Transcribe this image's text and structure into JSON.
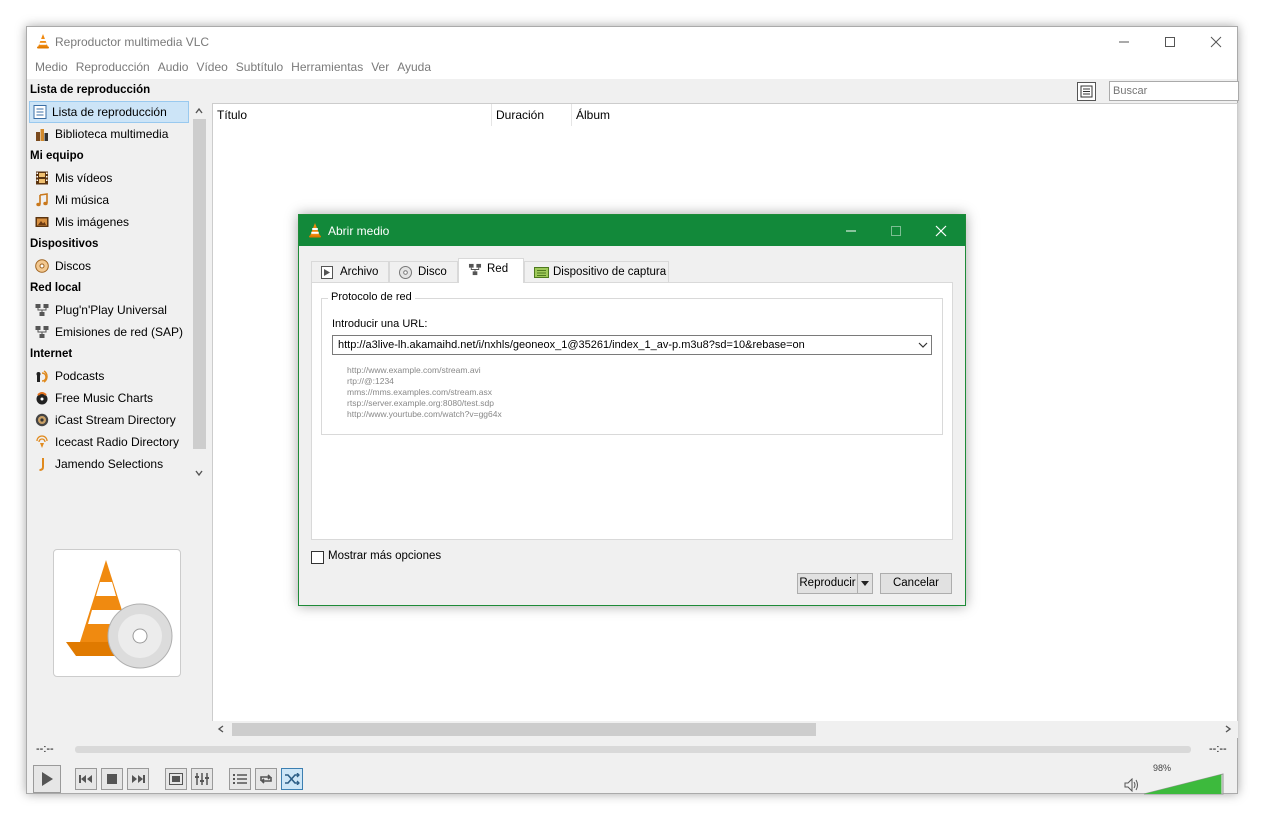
{
  "window": {
    "title": "Reproductor multimedia VLC"
  },
  "menu": [
    "Medio",
    "Reproducción",
    "Audio",
    "Vídeo",
    "Subtítulo",
    "Herramientas",
    "Ver",
    "Ayuda"
  ],
  "sidebar": {
    "header": "Lista de reproducción",
    "items": [
      {
        "type": "item",
        "label": "Lista de reproducción",
        "icon": "playlist-icon",
        "selected": true
      },
      {
        "type": "item",
        "label": "Biblioteca multimedia",
        "icon": "library-icon"
      },
      {
        "type": "section",
        "label": "Mi equipo"
      },
      {
        "type": "item",
        "label": "Mis vídeos",
        "icon": "film-icon"
      },
      {
        "type": "item",
        "label": "Mi música",
        "icon": "music-note-icon"
      },
      {
        "type": "item",
        "label": "Mis imágenes",
        "icon": "image-icon"
      },
      {
        "type": "section",
        "label": "Dispositivos"
      },
      {
        "type": "item",
        "label": "Discos",
        "icon": "disc-icon"
      },
      {
        "type": "section",
        "label": "Red local"
      },
      {
        "type": "item",
        "label": "Plug'n'Play Universal",
        "icon": "network-icon"
      },
      {
        "type": "item",
        "label": "Emisiones de red (SAP)",
        "icon": "network-icon"
      },
      {
        "type": "section",
        "label": "Internet"
      },
      {
        "type": "item",
        "label": "Podcasts",
        "icon": "podcast-icon"
      },
      {
        "type": "item",
        "label": "Free Music Charts",
        "icon": "charts-icon"
      },
      {
        "type": "item",
        "label": "iCast Stream Directory",
        "icon": "icast-icon"
      },
      {
        "type": "item",
        "label": "Icecast Radio Directory",
        "icon": "icecast-icon"
      },
      {
        "type": "item",
        "label": "Jamendo Selections",
        "icon": "jamendo-icon"
      }
    ]
  },
  "search": {
    "placeholder": "Buscar"
  },
  "playlist": {
    "columns": [
      "Título",
      "Duración",
      "Álbum"
    ]
  },
  "player": {
    "time_elapsed": "--:--",
    "time_total": "--:--",
    "volume": "98%",
    "volume_level": 0.98
  },
  "dialog": {
    "title": "Abrir medio",
    "tabs": [
      {
        "label": "Archivo",
        "icon": "file-icon"
      },
      {
        "label": "Disco",
        "icon": "disc-icon"
      },
      {
        "label": "Red",
        "icon": "network-icon",
        "active": true
      },
      {
        "label": "Dispositivo de captura",
        "icon": "capture-device-icon"
      }
    ],
    "group_title": "Protocolo de red",
    "url_label": "Introducir una URL:",
    "url_value": "http://a3live-lh.akamaihd.net/i/nxhls/geoneox_1@35261/index_1_av-p.m3u8?sd=10&rebase=on",
    "examples": [
      "http://www.example.com/stream.avi",
      "rtp://@:1234",
      "mms://mms.examples.com/stream.asx",
      "rtsp://server.example.org:8080/test.sdp",
      "http://www.yourtube.com/watch?v=gg64x"
    ],
    "more_options_label": "Mostrar más opciones",
    "play_button": "Reproducir",
    "cancel_button": "Cancelar"
  }
}
